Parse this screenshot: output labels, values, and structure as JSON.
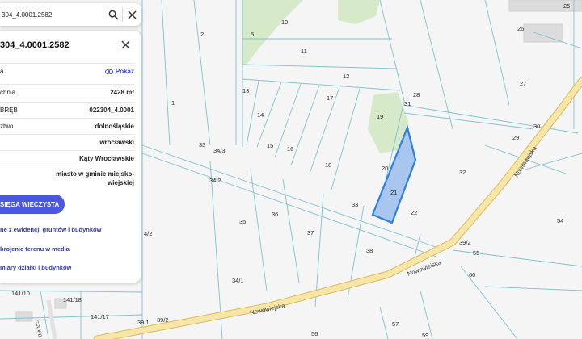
{
  "search": {
    "value": "304_4.0001.2582"
  },
  "panel": {
    "title": "304_4.0001.2582",
    "rows": [
      {
        "label": "a",
        "value": "",
        "link": "Pokaż"
      },
      {
        "label": "chnia",
        "value": "2428 m²"
      },
      {
        "label": "BRĘB",
        "value": "022304_4.0001"
      },
      {
        "label": "ztwo",
        "value": "dolnośląskie"
      },
      {
        "label": "",
        "value": "wrocławski"
      },
      {
        "label": "",
        "value": "Kąty Wrocławskie"
      },
      {
        "label": "",
        "value": "miasto w gminie miejsko-wiejskiej"
      }
    ],
    "kw_button": "SIĘGA WIECZYSTA",
    "links": [
      "ne z ewidencji gruntów i budynków",
      "brojenie terenu w media",
      "miary działki i budynków"
    ]
  },
  "map": {
    "road_name": "Nowowiejska",
    "selected_parcel": "21",
    "plot_labels": [
      "2",
      "1",
      "5",
      "10",
      "11",
      "12",
      "13",
      "14",
      "15",
      "16",
      "17",
      "18",
      "19",
      "20",
      "21",
      "22",
      "26",
      "27",
      "28",
      "29",
      "30",
      "31",
      "32",
      "33",
      "34/3",
      "33",
      "34/2",
      "35",
      "36",
      "37",
      "38",
      "34/1",
      "4/2",
      "39/2",
      "55",
      "54",
      "60",
      "57",
      "56",
      "59",
      "141/10",
      "141/18",
      "141/17",
      "39/1",
      "39/2",
      "25"
    ],
    "colors": {
      "selected_fill": "#a9c6ee",
      "selected_stroke": "#2e7fe0",
      "road_fill": "#f6e7a8",
      "road_stroke": "#d9b95a",
      "parcel_line": "#7fc3cf",
      "green": "#d6e9c8"
    }
  }
}
